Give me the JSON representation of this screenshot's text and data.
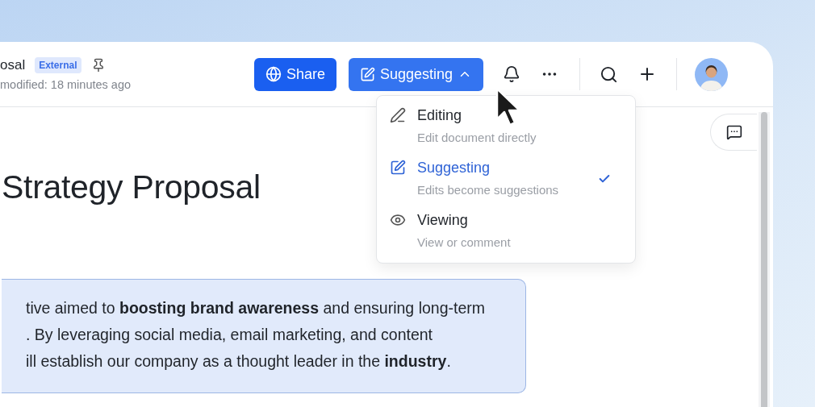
{
  "document": {
    "title": "osal",
    "badge": "External",
    "modified": "modified: 18 minutes ago",
    "heading": "Strategy Proposal",
    "callout_lines": [
      "tive aimed to **boosting brand  awareness** and ensuring long-term",
      ". By leveraging social media, email marketing, and content",
      "ill establish our company as a thought leader in the  **industry**."
    ]
  },
  "toolbar": {
    "share": "Share",
    "mode_button": "Suggesting",
    "menu_open": true
  },
  "mode_menu": [
    {
      "kind": "edit",
      "label": "Editing",
      "description": "Edit document directly",
      "selected": false
    },
    {
      "kind": "suggest",
      "label": "Suggesting",
      "description": "Edits become suggestions",
      "selected": true
    },
    {
      "kind": "view",
      "label": "Viewing",
      "description": "View or comment",
      "selected": false
    }
  ]
}
